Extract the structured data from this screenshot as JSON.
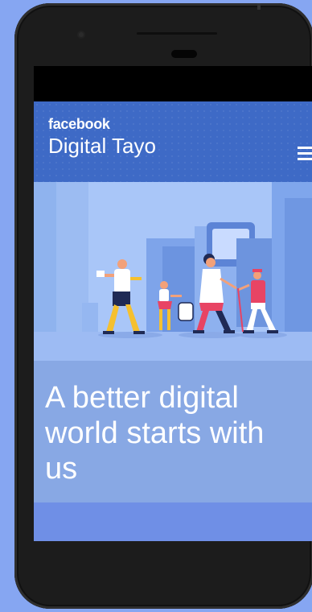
{
  "header": {
    "brand": "facebook",
    "site_title": "Digital Tayo",
    "menu_icon": "hamburger-menu-icon"
  },
  "hero": {
    "illustration": "people-walking-illustration"
  },
  "tagline": "A better digital world starts with us",
  "colors": {
    "page_bg": "#86a6f2",
    "header_bg": "#3e6ac6",
    "hero_bg": "#a9c6f8",
    "tagline_bg": "#88a8e4",
    "footer_bg": "#6f8fe6"
  }
}
